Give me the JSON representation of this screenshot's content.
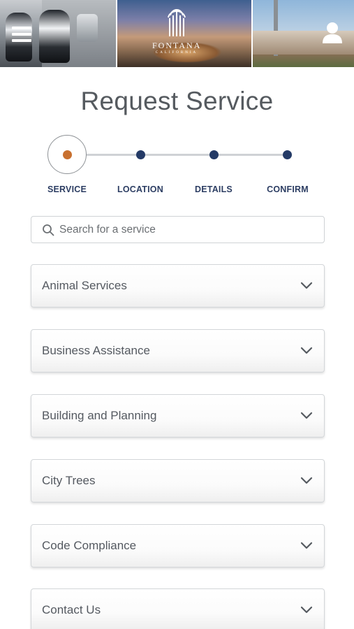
{
  "header": {
    "logo_word": "FONTANA",
    "logo_sub": "CALIFORNIA",
    "menu_icon": "hamburger-menu-icon",
    "user_icon": "user-account-icon"
  },
  "page": {
    "title": "Request Service"
  },
  "stepper": {
    "active_color": "#c8702f",
    "inactive_color": "#243a66",
    "steps": [
      {
        "label": "SERVICE",
        "active": true
      },
      {
        "label": "LOCATION",
        "active": false
      },
      {
        "label": "DETAILS",
        "active": false
      },
      {
        "label": "CONFIRM",
        "active": false
      }
    ]
  },
  "search": {
    "placeholder": "Search for a service",
    "value": "",
    "icon": "search-icon"
  },
  "categories": [
    {
      "label": "Animal Services"
    },
    {
      "label": "Business Assistance"
    },
    {
      "label": "Building and Planning"
    },
    {
      "label": "City Trees"
    },
    {
      "label": "Code Compliance"
    },
    {
      "label": "Contact Us"
    }
  ]
}
